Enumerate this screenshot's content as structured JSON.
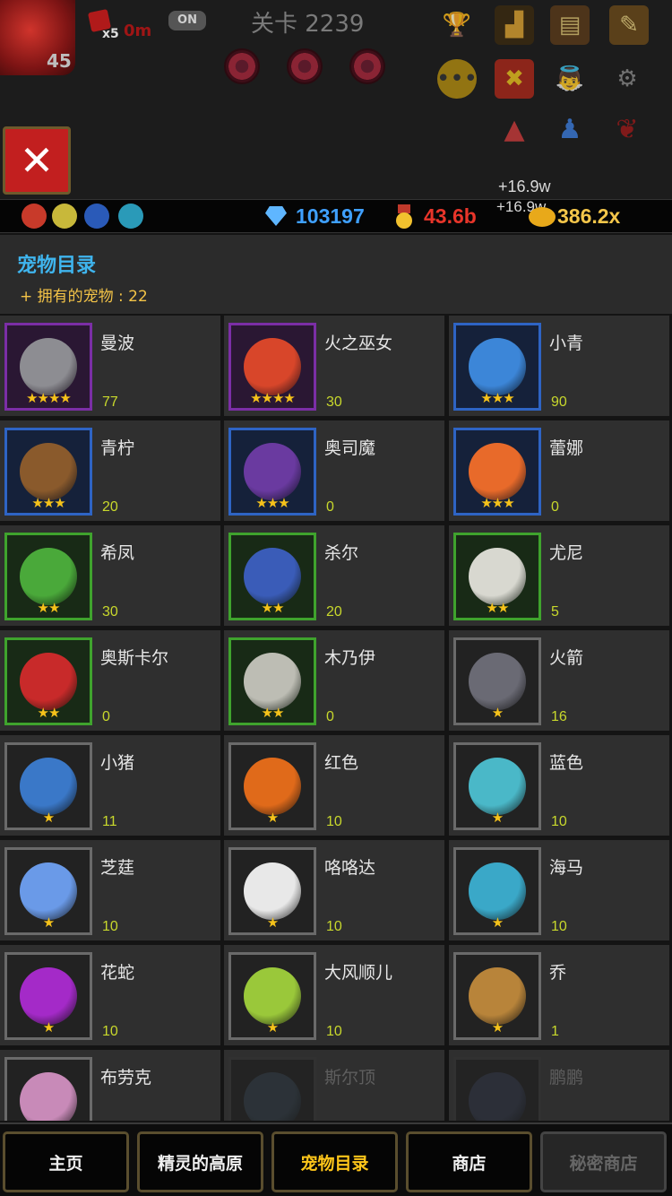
{
  "hud": {
    "player_level": "45",
    "multiplier": "x5",
    "timer": "0m",
    "toggle": "ON",
    "stage": "关卡 2239",
    "gains": [
      "+16.9w",
      "+16.9w"
    ]
  },
  "currency": {
    "gems": "103197",
    "medals": "43.6b",
    "gold_rate": "386.2x",
    "gem_color": "#3fa0ff",
    "medal_color": "#e8352a",
    "gold_color": "#f4c64a"
  },
  "header": {
    "title": "宠物目录",
    "owned": "+ 拥有的宠物 : 22"
  },
  "pets": [
    {
      "name": "曼波",
      "count": "77",
      "stars": "★★★★",
      "rarity": "purple",
      "art": "#8d8d92"
    },
    {
      "name": "火之巫女",
      "count": "30",
      "stars": "★★★★",
      "rarity": "purple",
      "art": "#d8462a"
    },
    {
      "name": "小青",
      "count": "90",
      "stars": "★★★",
      "rarity": "blue",
      "art": "#3c86d8"
    },
    {
      "name": "青柠",
      "count": "20",
      "stars": "★★★",
      "rarity": "blue",
      "art": "#8a5a2c"
    },
    {
      "name": "奥司魔",
      "count": "0",
      "stars": "★★★",
      "rarity": "blue",
      "art": "#6a3aa0"
    },
    {
      "name": "蕾娜",
      "count": "0",
      "stars": "★★★",
      "rarity": "blue",
      "art": "#e86a2a"
    },
    {
      "name": "希凤",
      "count": "30",
      "stars": "★★",
      "rarity": "green",
      "art": "#4aa93a"
    },
    {
      "name": "杀尔",
      "count": "20",
      "stars": "★★",
      "rarity": "green",
      "art": "#3a5cb8"
    },
    {
      "name": "尤尼",
      "count": "5",
      "stars": "★★",
      "rarity": "green",
      "art": "#d8d8d0"
    },
    {
      "name": "奥斯卡尔",
      "count": "0",
      "stars": "★★",
      "rarity": "green",
      "art": "#c82a2a"
    },
    {
      "name": "木乃伊",
      "count": "0",
      "stars": "★★",
      "rarity": "green",
      "art": "#bdbdb4"
    },
    {
      "name": "火箭",
      "count": "16",
      "stars": "★",
      "rarity": "grey",
      "art": "#6a6a74"
    },
    {
      "name": "小猪",
      "count": "11",
      "stars": "★",
      "rarity": "grey",
      "art": "#3a78c8"
    },
    {
      "name": "红色",
      "count": "10",
      "stars": "★",
      "rarity": "grey",
      "art": "#e06a1a"
    },
    {
      "name": "蓝色",
      "count": "10",
      "stars": "★",
      "rarity": "grey",
      "art": "#4ab8c8"
    },
    {
      "name": "芝莛",
      "count": "10",
      "stars": "★",
      "rarity": "grey",
      "art": "#6a9ae8"
    },
    {
      "name": "咯咯达",
      "count": "10",
      "stars": "★",
      "rarity": "grey",
      "art": "#e8e8e8"
    },
    {
      "name": "海马",
      "count": "10",
      "stars": "★",
      "rarity": "grey",
      "art": "#3aa8c8"
    },
    {
      "name": "花蛇",
      "count": "10",
      "stars": "★",
      "rarity": "grey",
      "art": "#a42ac8"
    },
    {
      "name": "大风顺儿",
      "count": "10",
      "stars": "★",
      "rarity": "grey",
      "art": "#9ac83a"
    },
    {
      "name": "乔",
      "count": "1",
      "stars": "★",
      "rarity": "grey",
      "art": "#b8843a"
    },
    {
      "name": "布劳克",
      "count": "",
      "stars": "",
      "rarity": "grey",
      "art": "#c88ab8"
    },
    {
      "name": "斯尔顶",
      "count": "",
      "stars": "",
      "rarity": "locked",
      "art": "#2a3640"
    },
    {
      "name": "鹏鹏",
      "count": "",
      "stars": "",
      "rarity": "locked",
      "art": "#2a3040"
    }
  ],
  "nav": {
    "home": "主页",
    "plateau": "精灵的高原",
    "catalog": "宠物目录",
    "shop": "商店",
    "secret_shop": "秘密商店"
  }
}
